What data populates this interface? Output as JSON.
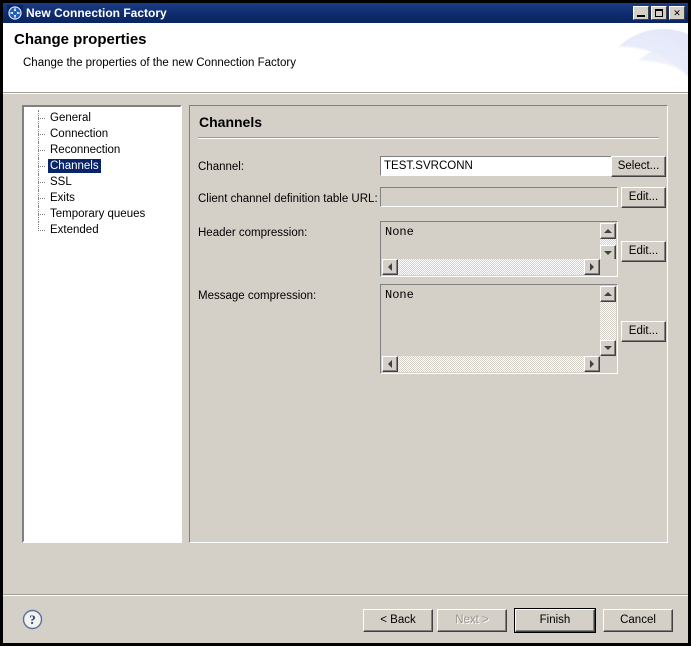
{
  "window": {
    "title": "New Connection Factory",
    "icon": "connection-factory-icon",
    "controls": {
      "minimize": "minimize-button",
      "maximize": "maximize-button",
      "close_glyph": "✕"
    }
  },
  "header": {
    "title": "Change properties",
    "subtitle": "Change the properties of the new Connection Factory"
  },
  "tree": {
    "items": [
      {
        "label": "General",
        "selected": false
      },
      {
        "label": "Connection",
        "selected": false
      },
      {
        "label": "Reconnection",
        "selected": false
      },
      {
        "label": "Channels",
        "selected": true
      },
      {
        "label": "SSL",
        "selected": false
      },
      {
        "label": "Exits",
        "selected": false
      },
      {
        "label": "Temporary queues",
        "selected": false
      },
      {
        "label": "Extended",
        "selected": false
      }
    ]
  },
  "panel": {
    "title": "Channels",
    "fields": {
      "channel": {
        "label": "Channel:",
        "value": "TEST.SVRCONN",
        "placeholder": "",
        "button": "Select...",
        "enabled": true
      },
      "ccdt_url": {
        "label": "Client channel definition table URL:",
        "value": "",
        "placeholder": "",
        "button": "Edit...",
        "enabled": false
      },
      "header_compression": {
        "label": "Header compression:",
        "value": "None",
        "button": "Edit..."
      },
      "message_compression": {
        "label": "Message compression:",
        "value": "None",
        "button": "Edit..."
      }
    }
  },
  "footer": {
    "help_icon": "help-icon",
    "buttons": {
      "back": {
        "label": "< Back",
        "enabled": true,
        "default": false
      },
      "next": {
        "label": "Next >",
        "enabled": false,
        "default": false
      },
      "finish": {
        "label": "Finish",
        "enabled": true,
        "default": true
      },
      "cancel": {
        "label": "Cancel",
        "enabled": true,
        "default": false
      }
    }
  },
  "colors": {
    "titlebar_start": "#1b3d85",
    "titlebar_end": "#0a2560",
    "selection": "#0a246a",
    "face": "#d4d0c8",
    "banner": "#ffffff"
  }
}
